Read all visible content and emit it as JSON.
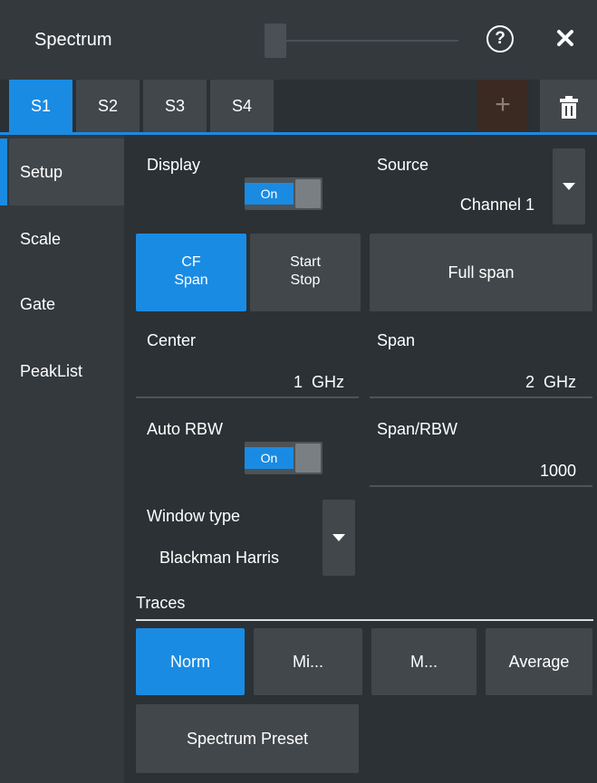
{
  "window": {
    "title": "Spectrum"
  },
  "tabs": [
    {
      "label": "S1",
      "active": true
    },
    {
      "label": "S2",
      "active": false
    },
    {
      "label": "S3",
      "active": false
    },
    {
      "label": "S4",
      "active": false
    }
  ],
  "sidebar": {
    "items": [
      {
        "label": "Setup",
        "active": true
      },
      {
        "label": "Scale",
        "active": false
      },
      {
        "label": "Gate",
        "active": false
      },
      {
        "label": "PeakList",
        "active": false
      }
    ]
  },
  "display": {
    "label": "Display",
    "toggle": "On"
  },
  "source": {
    "label": "Source",
    "value": "Channel 1"
  },
  "mode": {
    "cf_span": [
      "CF",
      "Span"
    ],
    "start_stop": [
      "Start",
      "Stop"
    ],
    "full_span": "Full span"
  },
  "center": {
    "label": "Center",
    "value": "1  GHz"
  },
  "span": {
    "label": "Span",
    "value": "2  GHz"
  },
  "auto_rbw": {
    "label": "Auto RBW",
    "toggle": "On"
  },
  "span_rbw": {
    "label": "Span/RBW",
    "value": "1000"
  },
  "window_type": {
    "label": "Window type",
    "value": "Blackman Harris"
  },
  "traces": {
    "label": "Traces",
    "buttons": [
      "Norm",
      "Mi...",
      "M...",
      "Average"
    ]
  },
  "preset": {
    "label": "Spectrum Preset"
  },
  "colors": {
    "accent": "#1a8be3",
    "panel": "#2b3135",
    "sidebar": "#33393d",
    "button": "#41474b"
  },
  "icons": {
    "help": "help-circle-icon",
    "close": "close-icon",
    "add": "plus-icon",
    "delete": "trash-icon",
    "dropdown": "caret-down-icon"
  }
}
